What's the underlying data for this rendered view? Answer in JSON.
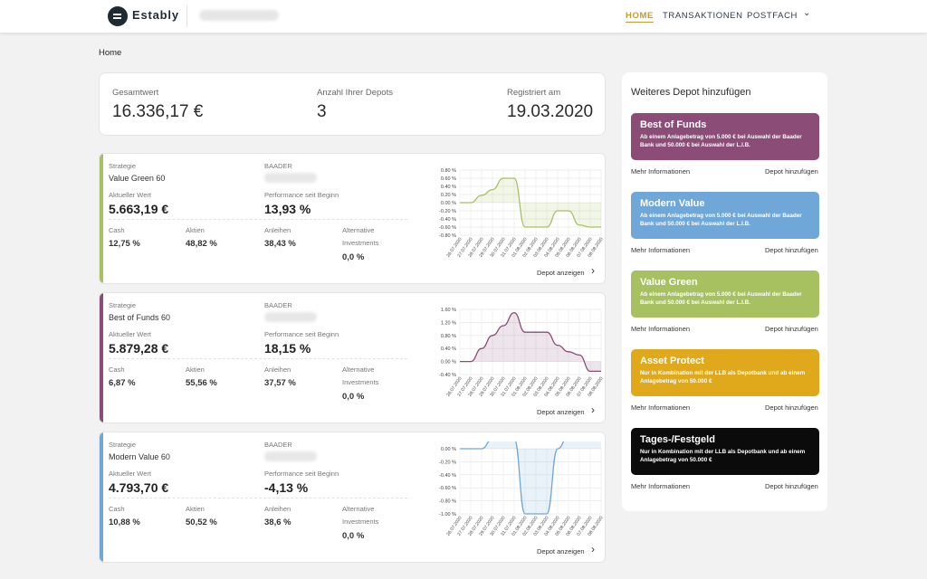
{
  "header": {
    "brand": "Estably",
    "nav": [
      {
        "label": "HOME"
      },
      {
        "label": "TRANSAKTIONEN"
      },
      {
        "label": "POSTFACH"
      }
    ]
  },
  "breadcrumb": "Home",
  "summary": [
    {
      "label": "Gesamtwert",
      "value": "16.336,17 €"
    },
    {
      "label": "Anzahl Ihrer Depots",
      "value": "3"
    },
    {
      "label": "Registriert am",
      "value": "19.03.2020"
    }
  ],
  "depot_labels": {
    "strategy": "Strategie",
    "bank": "BAADER",
    "current_value": "Aktueller Wert",
    "performance": "Performance seit Beginn",
    "cash": "Cash",
    "stocks": "Aktien",
    "bonds": "Anleihen",
    "alternative_1": "Alternative",
    "alternative_2": "Investments",
    "show_depot": "Depot anzeigen"
  },
  "depots": [
    {
      "strategy": "Value Green 60",
      "value": "5.663,19 €",
      "performance": "13,93 %",
      "cash": "12,75 %",
      "stocks": "48,82 %",
      "bonds": "38,43 %",
      "alternative": "0,0 %",
      "accent": "#a7c160"
    },
    {
      "strategy": "Best of Funds 60",
      "value": "5.879,28 €",
      "performance": "18,15 %",
      "cash": "6,87 %",
      "stocks": "55,56 %",
      "bonds": "37,57 %",
      "alternative": "0,0 %",
      "accent": "#8b4d77"
    },
    {
      "strategy": "Modern Value 60",
      "value": "4.793,70 €",
      "performance": "-4,13 %",
      "cash": "10,88 %",
      "stocks": "50,52 %",
      "bonds": "38,6 %",
      "alternative": "0,0 %",
      "accent": "#6ea7d8"
    }
  ],
  "chart_data": [
    {
      "type": "line",
      "x": [
        "26.07.2020",
        "27.07.2020",
        "28.07.2020",
        "29.07.2020",
        "30.07.2020",
        "31.07.2020",
        "01.08.2020",
        "02.08.2020",
        "03.08.2020",
        "04.08.2020",
        "05.08.2020",
        "06.08.2020",
        "07.08.2020",
        "08.08.2020"
      ],
      "y": [
        0.0,
        0.0,
        0.18,
        0.32,
        0.6,
        0.6,
        -0.6,
        -0.6,
        -0.6,
        -0.2,
        -0.2,
        -0.55,
        -0.6,
        -0.6
      ],
      "yticks": [
        "0.80 %",
        "0.60 %",
        "0.40 %",
        "0.20 %",
        "0.00 %",
        "-0.20 %",
        "-0.40 %",
        "-0.60 %",
        "-0.80 %"
      ],
      "ylim": [
        -0.8,
        0.8
      ],
      "color": "#a7c160"
    },
    {
      "type": "line",
      "x": [
        "26.07.2020",
        "27.07.2020",
        "28.07.2020",
        "29.07.2020",
        "30.07.2020",
        "31.07.2020",
        "01.08.2020",
        "02.08.2020",
        "03.08.2020",
        "04.08.2020",
        "05.08.2020",
        "06.08.2020",
        "07.08.2020",
        "08.08.2020"
      ],
      "y": [
        0.0,
        0.0,
        0.4,
        0.8,
        1.1,
        1.5,
        0.9,
        0.9,
        0.9,
        0.5,
        0.3,
        0.2,
        -0.3,
        -0.3
      ],
      "yticks": [
        "1.60 %",
        "1.20 %",
        "0.80 %",
        "0.40 %",
        "0.00 %",
        "-0.40 %"
      ],
      "ylim": [
        -0.4,
        1.6
      ],
      "color": "#8b4d77"
    },
    {
      "type": "line",
      "x": [
        "26.07.2020",
        "27.07.2020",
        "28.07.2020",
        "29.07.2020",
        "30.07.2020",
        "31.07.2020",
        "01.08.2020",
        "02.08.2020",
        "03.08.2020",
        "04.08.2020",
        "05.08.2020",
        "06.08.2020",
        "07.08.2020",
        "08.08.2020"
      ],
      "y": [
        0.0,
        0.0,
        0.0,
        0.15,
        0.15,
        0.15,
        -1.0,
        -1.0,
        -1.0,
        0.0,
        0.2,
        0.2,
        0.2,
        0.4
      ],
      "yticks": [
        "0.00 %",
        "-0.20 %",
        "-0.40 %",
        "-0.60 %",
        "-0.80 %",
        "-1.00 %"
      ],
      "ylim": [
        -1.0,
        0.0
      ],
      "color": "#6ea7d8"
    }
  ],
  "right_panel": {
    "title": "Weiteres Depot hinzufügen",
    "more_info": "Mehr Informationen",
    "add_depot": "Depot hinzufügen",
    "products": [
      {
        "title": "Best of Funds",
        "desc": "Ab einem Anlagebetrag von 5.000 € bei Auswahl der Baader Bank und 50.000 € bei Auswahl der L.I.B.",
        "color": "#8b4d77"
      },
      {
        "title": "Modern Value",
        "desc": "Ab einem Anlagebetrag von 5.000 € bei Auswahl der Baader Bank und 50.000 € bei Auswahl der L.I.B.",
        "color": "#6ea7d8"
      },
      {
        "title": "Value Green",
        "desc": "Ab einem Anlagebetrag von 5.000 € bei Auswahl der Baader Bank und 50.000 € bei Auswahl der L.I.B.",
        "color": "#a7c160"
      },
      {
        "title": "Asset Protect",
        "desc": "Nur in Kombination mit der LLB als Depotbank und ab einem Anlagebetrag von 50.000 €",
        "color": "#e0a91c"
      },
      {
        "title": "Tages-/Festgeld",
        "desc": "Nur in Kombination mit der LLB als Depotbank und ab einem Anlagebetrag von 50.000 €",
        "color": "#0b0b0b"
      }
    ]
  }
}
